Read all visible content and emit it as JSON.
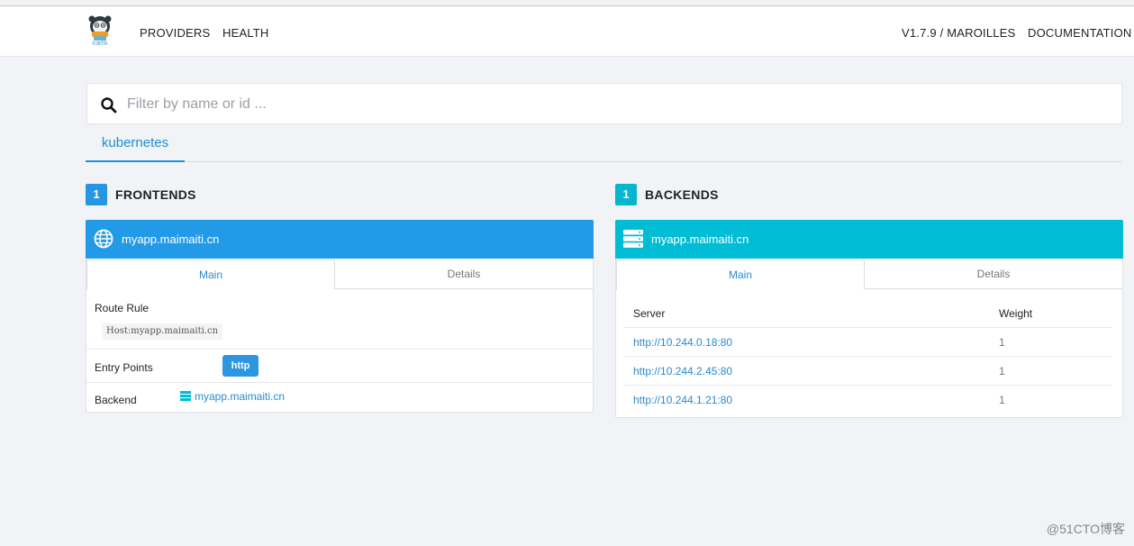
{
  "nav": {
    "logo_text": "træfik",
    "providers": "PROVIDERS",
    "health": "HEALTH",
    "version": "V1.7.9 / MAROILLES",
    "documentation": "DOCUMENTATION"
  },
  "search": {
    "placeholder": "Filter by name or id ..."
  },
  "provider_tab": "kubernetes",
  "frontends": {
    "count": "1",
    "title": "FRONTENDS",
    "card": {
      "title": "myapp.maimaiti.cn",
      "tabs": {
        "main": "Main",
        "details": "Details"
      },
      "route_rule_label": "Route Rule",
      "route_rule_value": "Host:myapp.maimaiti.cn",
      "entry_points_label": "Entry Points",
      "entry_point": "http",
      "backend_label": "Backend",
      "backend_link": "myapp.maimaiti.cn"
    }
  },
  "backends": {
    "count": "1",
    "title": "BACKENDS",
    "card": {
      "title": "myapp.maimaiti.cn",
      "tabs": {
        "main": "Main",
        "details": "Details"
      },
      "columns": {
        "server": "Server",
        "weight": "Weight"
      },
      "rows": [
        {
          "server": "http://10.244.0.18:80",
          "weight": "1"
        },
        {
          "server": "http://10.244.2.45:80",
          "weight": "1"
        },
        {
          "server": "http://10.244.1.21:80",
          "weight": "1"
        }
      ]
    }
  },
  "watermark": "@51CTO博客",
  "colors": {
    "frontend_accent": "#239ae8",
    "backend_accent": "#00bcd4",
    "link": "#2a8bd2",
    "page_bg": "#f1f3f6"
  }
}
